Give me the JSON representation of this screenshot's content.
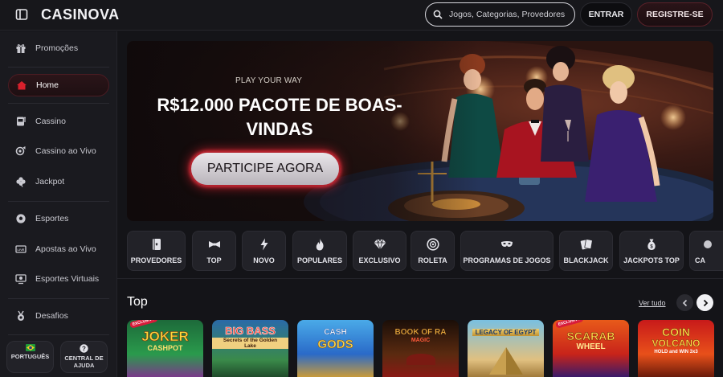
{
  "header": {
    "logo": "CASINOVA",
    "search_placeholder": "Jogos, Categorias, Provedores",
    "login_label": "ENTRAR",
    "register_label": "REGISTRE-SE"
  },
  "sidebar": {
    "items": [
      {
        "label": "Promoções",
        "icon": "gift-icon"
      },
      {
        "label": "Home",
        "icon": "home-icon",
        "active": true
      },
      {
        "label": "Cassino",
        "icon": "slot-machine-icon"
      },
      {
        "label": "Cassino ao Vivo",
        "icon": "live-casino-icon"
      },
      {
        "label": "Jackpot",
        "icon": "clover-icon"
      },
      {
        "label": "Esportes",
        "icon": "soccer-ball-icon"
      },
      {
        "label": "Apostas ao Vivo",
        "icon": "live-tv-icon"
      },
      {
        "label": "Esportes Virtuais",
        "icon": "virtual-sports-icon"
      },
      {
        "label": "Desafios",
        "icon": "medal-icon"
      }
    ],
    "footer": {
      "language_label": "PORTUGUÊS",
      "help_line1": "CENTRAL DE",
      "help_line2": "AJUDA"
    }
  },
  "hero": {
    "subtitle": "PLAY YOUR WAY",
    "title": "R$12.000 PACOTE DE BOAS-VINDAS",
    "cta_label": "PARTICIPE AGORA"
  },
  "categories": [
    {
      "label": "PROVEDORES",
      "icon": "provider-cards-icon"
    },
    {
      "label": "TOP",
      "icon": "bowtie-icon"
    },
    {
      "label": "NOVO",
      "icon": "lightning-icon"
    },
    {
      "label": "POPULARES",
      "icon": "flame-icon"
    },
    {
      "label": "EXCLUSIVO",
      "icon": "diamond-icon"
    },
    {
      "label": "ROLETA",
      "icon": "roulette-icon"
    },
    {
      "label": "PROGRAMAS DE JOGOS",
      "icon": "mask-icon"
    },
    {
      "label": "BLACKJACK",
      "icon": "playing-cards-icon"
    },
    {
      "label": "JACKPOTS TOP",
      "icon": "money-bag-icon"
    },
    {
      "label": "CA",
      "icon": "more-icon"
    }
  ],
  "top_section": {
    "title": "Top",
    "see_all_label": "Ver tudo",
    "games": [
      {
        "title": "JOKER",
        "subtitle": "CASHPOT",
        "badge": "EXCLUSIVO"
      },
      {
        "title": "BIG BASS",
        "subtitle": "Secrets of the Golden Lake"
      },
      {
        "title": "CASH",
        "subtitle": "GODS"
      },
      {
        "title": "BOOK OF RA",
        "subtitle": "MAGIC"
      },
      {
        "title": "LEGACY OF EGYPT",
        "subtitle": ""
      },
      {
        "title": "SCARAB",
        "subtitle": "WHEEL",
        "badge": "EXCLUSIVO"
      },
      {
        "title": "COIN",
        "subtitle": "VOLCANO",
        "extra": "HOLD and WIN 3x3"
      }
    ]
  },
  "colors": {
    "background": "#141418",
    "accent_red": "#c8202d",
    "sidebar": "#1a1a1f"
  }
}
